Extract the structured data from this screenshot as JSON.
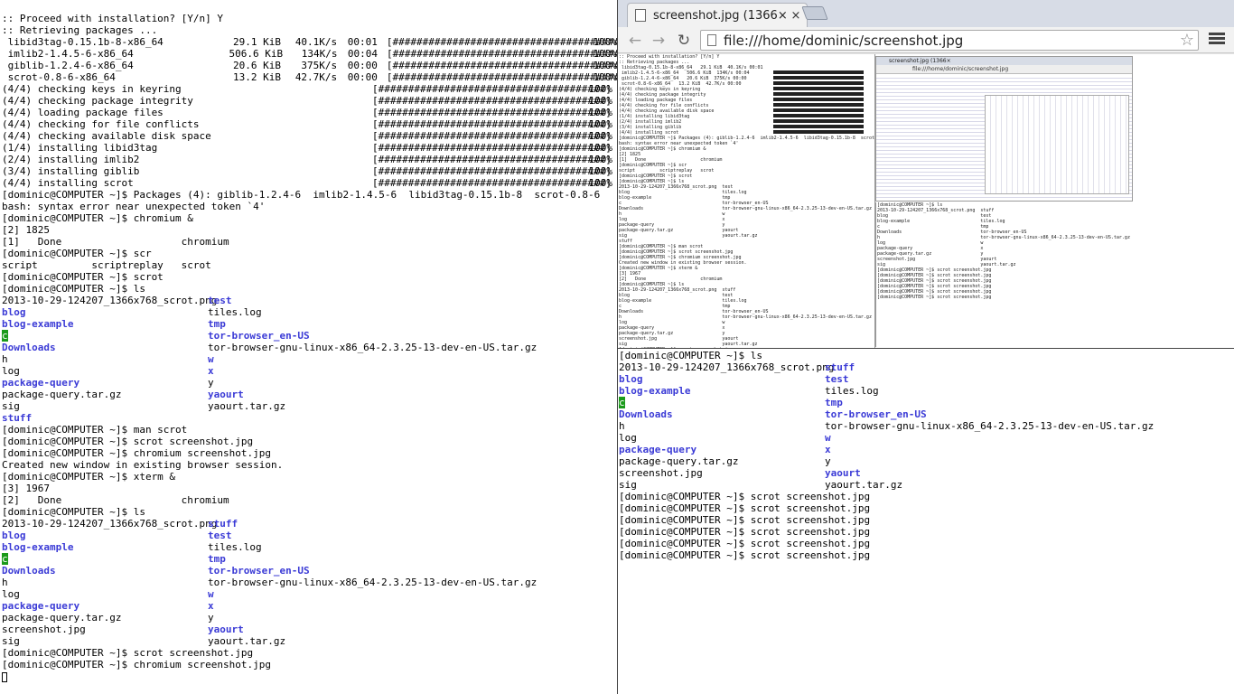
{
  "left_terminal": {
    "header_lines": [
      ":: Proceed with installation? [Y/n] Y",
      ":: Retrieving packages ..."
    ],
    "downloads": [
      {
        "name": " libid3tag-0.15.1b-8-x86_64",
        "size": "29.1 KiB",
        "rate": "40.1K/s",
        "time": "00:01",
        "bar": "[######################################]",
        "pct": "100%"
      },
      {
        "name": " imlib2-1.4.5-6-x86_64",
        "size": "506.6 KiB",
        "rate": "134K/s",
        "time": "00:04",
        "bar": "[######################################]",
        "pct": "100%"
      },
      {
        "name": " giblib-1.2.4-6-x86_64",
        "size": "20.6 KiB",
        "rate": "375K/s",
        "time": "00:00",
        "bar": "[######################################]",
        "pct": "100%"
      },
      {
        "name": " scrot-0.8-6-x86_64",
        "size": "13.2 KiB",
        "rate": "42.7K/s",
        "time": "00:00",
        "bar": "[######################################]",
        "pct": "100%"
      }
    ],
    "steps": [
      {
        "label": "(4/4) checking keys in keyring",
        "bar": "[######################################]",
        "pct": "100%"
      },
      {
        "label": "(4/4) checking package integrity",
        "bar": "[######################################]",
        "pct": "100%"
      },
      {
        "label": "(4/4) loading package files",
        "bar": "[######################################]",
        "pct": "100%"
      },
      {
        "label": "(4/4) checking for file conflicts",
        "bar": "[######################################]",
        "pct": "100%"
      },
      {
        "label": "(4/4) checking available disk space",
        "bar": "[######################################]",
        "pct": "100%"
      },
      {
        "label": "(1/4) installing libid3tag",
        "bar": "[######################################]",
        "pct": "100%"
      },
      {
        "label": "(2/4) installing imlib2",
        "bar": "[######################################]",
        "pct": "100%"
      },
      {
        "label": "(3/4) installing giblib",
        "bar": "[######################################]",
        "pct": "100%"
      },
      {
        "label": "(4/4) installing scrot",
        "bar": "[######################################]",
        "pct": "100%"
      }
    ],
    "block1": [
      "[dominic@COMPUTER ~]$ Packages (4): giblib-1.2.4-6  imlib2-1.4.5-6  libid3tag-0.15.1b-8  scrot-0.8-6",
      "bash: syntax error near unexpected token `4'",
      "[dominic@COMPUTER ~]$ chromium &",
      "[2] 1825",
      "[1]   Done                    chromium",
      "[dominic@COMPUTER ~]$ scr",
      "script         scriptreplay   scrot",
      "[dominic@COMPUTER ~]$ scrot",
      "[dominic@COMPUTER ~]$ ls"
    ],
    "ls1": [
      {
        "a": "2013-10-29-124207_1366x768_scrot.png",
        "ab": false,
        "b": "test",
        "bb": true
      },
      {
        "a": "blog",
        "ab": true,
        "b": "tiles.log",
        "bb": false
      },
      {
        "a": "blog-example",
        "ab": true,
        "b": "tmp",
        "bb": true
      },
      {
        "a": "c",
        "ab": "green",
        "b": "tor-browser_en-US",
        "bb": true
      },
      {
        "a": "Downloads",
        "ab": true,
        "b": "tor-browser-gnu-linux-x86_64-2.3.25-13-dev-en-US.tar.gz",
        "bb": false
      },
      {
        "a": "h",
        "ab": false,
        "b": "w",
        "bb": true
      },
      {
        "a": "log",
        "ab": false,
        "b": "x",
        "bb": true
      },
      {
        "a": "package-query",
        "ab": true,
        "b": "y",
        "bb": false
      },
      {
        "a": "package-query.tar.gz",
        "ab": false,
        "b": "yaourt",
        "bb": true
      },
      {
        "a": "sig",
        "ab": false,
        "b": "yaourt.tar.gz",
        "bb": false
      },
      {
        "a": "stuff",
        "ab": true,
        "b": "",
        "bb": false
      }
    ],
    "block2": [
      "[dominic@COMPUTER ~]$ man scrot",
      "[dominic@COMPUTER ~]$ scrot screenshot.jpg",
      "[dominic@COMPUTER ~]$ chromium screenshot.jpg",
      "Created new window in existing browser session.",
      "[dominic@COMPUTER ~]$ xterm &",
      "[3] 1967",
      "[2]   Done                    chromium",
      "[dominic@COMPUTER ~]$ ls"
    ],
    "ls2": [
      {
        "a": "2013-10-29-124207_1366x768_scrot.png",
        "ab": false,
        "b": "stuff",
        "bb": true
      },
      {
        "a": "blog",
        "ab": true,
        "b": "test",
        "bb": true
      },
      {
        "a": "blog-example",
        "ab": true,
        "b": "tiles.log",
        "bb": false
      },
      {
        "a": "c",
        "ab": "green",
        "b": "tmp",
        "bb": true
      },
      {
        "a": "Downloads",
        "ab": true,
        "b": "tor-browser_en-US",
        "bb": true
      },
      {
        "a": "h",
        "ab": false,
        "b": "tor-browser-gnu-linux-x86_64-2.3.25-13-dev-en-US.tar.gz",
        "bb": false
      },
      {
        "a": "log",
        "ab": false,
        "b": "w",
        "bb": true
      },
      {
        "a": "package-query",
        "ab": true,
        "b": "x",
        "bb": true
      },
      {
        "a": "package-query.tar.gz",
        "ab": false,
        "b": "y",
        "bb": false
      },
      {
        "a": "screenshot.jpg",
        "ab": false,
        "b": "yaourt",
        "bb": true
      },
      {
        "a": "sig",
        "ab": false,
        "b": "yaourt.tar.gz",
        "bb": false
      }
    ],
    "block3": [
      "[dominic@COMPUTER ~]$ scrot screenshot.jpg",
      "[dominic@COMPUTER ~]$ chromium screenshot.jpg"
    ]
  },
  "browser": {
    "tab_title": "screenshot.jpg (1366×",
    "close_glyph": "×",
    "url": "file:///home/dominic/screenshot.jpg",
    "back_glyph": "←",
    "forward_glyph": "→",
    "reload_glyph": "↻",
    "star_glyph": "☆",
    "thumb_tab_title": "screenshot.jpg (1366×",
    "thumb_url": "file:///home/dominic/screenshot.jpg"
  },
  "right_terminal": {
    "head": "[dominic@COMPUTER ~]$ ls",
    "ls": [
      {
        "a": "2013-10-29-124207_1366x768_scrot.png",
        "ab": false,
        "b": "stuff",
        "bb": true
      },
      {
        "a": "blog",
        "ab": true,
        "b": "test",
        "bb": true
      },
      {
        "a": "blog-example",
        "ab": true,
        "b": "tiles.log",
        "bb": false
      },
      {
        "a": "c",
        "ab": "green",
        "b": "tmp",
        "bb": true
      },
      {
        "a": "Downloads",
        "ab": true,
        "b": "tor-browser_en-US",
        "bb": true
      },
      {
        "a": "h",
        "ab": false,
        "b": "tor-browser-gnu-linux-x86_64-2.3.25-13-dev-en-US.tar.gz",
        "bb": false
      },
      {
        "a": "log",
        "ab": false,
        "b": "w",
        "bb": true
      },
      {
        "a": "package-query",
        "ab": true,
        "b": "x",
        "bb": true
      },
      {
        "a": "package-query.tar.gz",
        "ab": false,
        "b": "y",
        "bb": false
      },
      {
        "a": "screenshot.jpg",
        "ab": false,
        "b": "yaourt",
        "bb": true
      },
      {
        "a": "sig",
        "ab": false,
        "b": "yaourt.tar.gz",
        "bb": false
      }
    ],
    "tail": [
      "[dominic@COMPUTER ~]$ scrot screenshot.jpg",
      "[dominic@COMPUTER ~]$ scrot screenshot.jpg",
      "[dominic@COMPUTER ~]$ scrot screenshot.jpg",
      "[dominic@COMPUTER ~]$ scrot screenshot.jpg",
      "[dominic@COMPUTER ~]$ scrot screenshot.jpg",
      "[dominic@COMPUTER ~]$ scrot screenshot.jpg"
    ]
  },
  "colors": {
    "dir": "#3b3bd6",
    "exec_bg": "#1a9a1a",
    "tabstrip": "#d7dce6"
  },
  "icons": [
    "back-arrow-icon",
    "forward-arrow-icon",
    "reload-icon",
    "page-icon",
    "bookmark-star-icon",
    "menu-icon",
    "tab-close-icon",
    "favicon"
  ]
}
